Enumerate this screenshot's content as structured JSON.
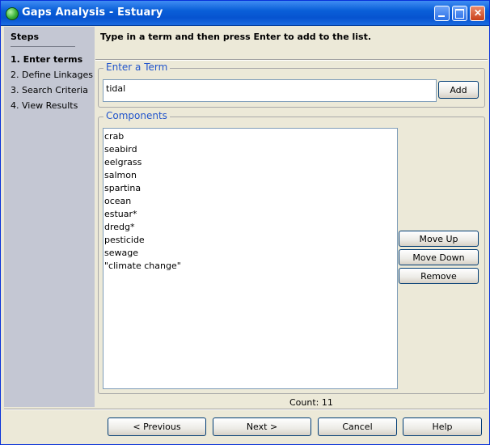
{
  "window": {
    "title": "Gaps Analysis - Estuary"
  },
  "sidebar": {
    "title": "Steps",
    "items": [
      {
        "label": "1. Enter terms",
        "active": true
      },
      {
        "label": "2. Define Linkages"
      },
      {
        "label": "3. Search Criteria"
      },
      {
        "label": "4. View Results"
      }
    ]
  },
  "main": {
    "instruction": "Type in a term and then press Enter to add to the list.",
    "term_group": {
      "legend": "Enter a Term",
      "value": "tidal",
      "add_label": "Add"
    },
    "components": {
      "legend": "Components",
      "items": [
        "crab",
        "seabird",
        "eelgrass",
        "salmon",
        "spartina",
        "ocean",
        "estuar*",
        "dredg*",
        "pesticide",
        "sewage",
        "\"climate change\""
      ],
      "move_up_label": "Move Up",
      "move_down_label": "Move Down",
      "remove_label": "Remove",
      "count_text": "Count: 11"
    }
  },
  "footer": {
    "previous_label": "< Previous",
    "next_label": "Next >",
    "cancel_label": "Cancel",
    "help_label": "Help"
  }
}
